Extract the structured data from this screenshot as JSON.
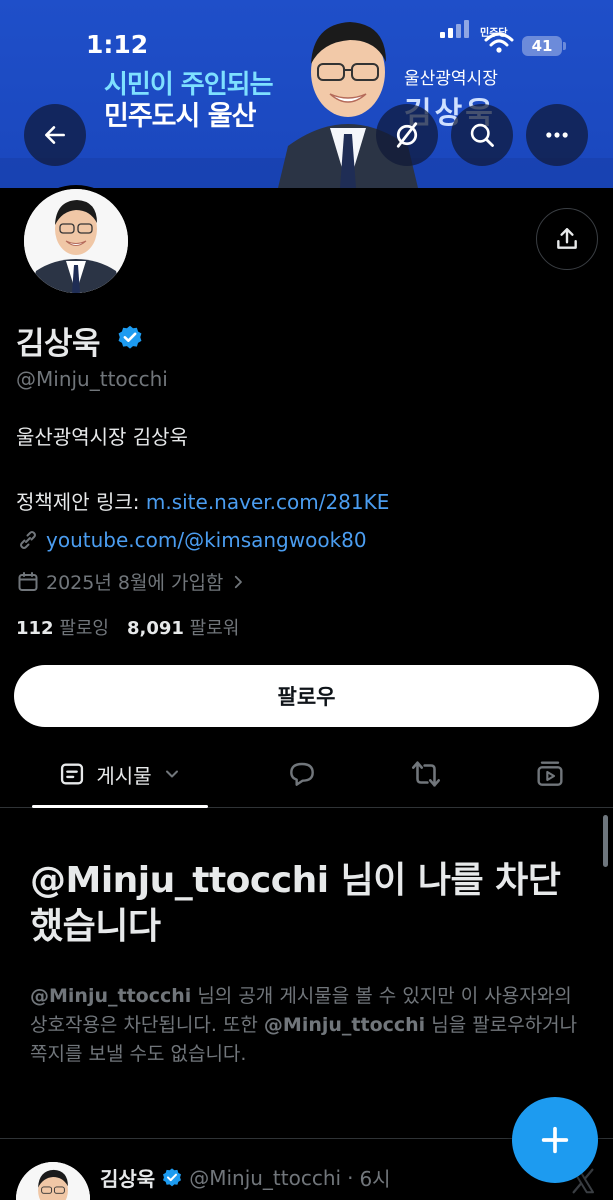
{
  "status_bar": {
    "time": "1:12",
    "battery": "41",
    "operator": "민주당"
  },
  "banner": {
    "slogan_line1": "시민이 주인되는",
    "slogan_line2": "민주도시 울산",
    "title": "울산광역시장",
    "name": "김상욱"
  },
  "profile": {
    "name": "김상욱",
    "handle": "@Minju_ttocchi",
    "bio": "울산광역시장 김상욱",
    "policy_label": "정책제안 링크: ",
    "policy_link": "m.site.naver.com/281KE",
    "website": "youtube.com/@kimsangwook80",
    "joined": "2025년 8월에 가입함",
    "following_count": "112",
    "following_label": "팔로잉",
    "followers_count": "8,091",
    "followers_label": "팔로워",
    "follow_button": "팔로우"
  },
  "tabs": {
    "posts_label": "게시물"
  },
  "blocked": {
    "title_handle": "@Minju_ttocchi",
    "title_rest_1": " 님이 나를 차단",
    "title_rest_2": "했습니다",
    "desc_handle_1": "@Minju_ttocchi",
    "desc_part_1": " 님의 공개 게시물을 볼 수 있지만 이 사용자와의 상호작용은 차단됩니다. 또한 ",
    "desc_handle_2": "@Minju_ttocchi",
    "desc_part_2": " 님을 팔로우하거나 쪽지를 보낼 수도 없습니다."
  },
  "post": {
    "author_name": "김상욱",
    "author_handle": "@Minju_ttocchi",
    "separator": "·",
    "time": "6시"
  },
  "colors": {
    "link": "#4b9df0",
    "verified": "#1d9bf0",
    "fab": "#1d9bf0",
    "banner": "#1f4fc9"
  },
  "icons": [
    "back-arrow-icon",
    "no-search-icon",
    "search-icon",
    "more-icon",
    "share-icon",
    "verified-icon",
    "link-icon",
    "calendar-icon",
    "chevron-right-icon",
    "posts-icon",
    "chevron-down-icon",
    "replies-icon",
    "retweet-icon",
    "media-icon",
    "plus-icon",
    "x-logo-icon"
  ]
}
